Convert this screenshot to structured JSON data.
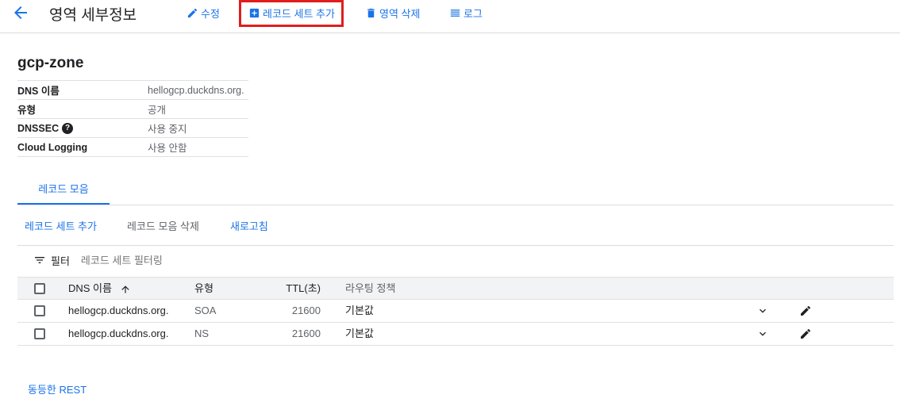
{
  "header": {
    "title": "영역 세부정보",
    "buttons": {
      "edit": "수정",
      "add_record_set": "레코드 세트 추가",
      "delete_zone": "영역 삭제",
      "logs": "로그"
    }
  },
  "zone": {
    "name": "gcp-zone",
    "details": [
      {
        "label": "DNS 이름",
        "value": "hellogcp.duckdns.org."
      },
      {
        "label": "유형",
        "value": "공개"
      },
      {
        "label": "DNSSEC",
        "value": "사용 중지"
      },
      {
        "label": "Cloud Logging",
        "value": "사용 안함"
      }
    ]
  },
  "tabs": [
    {
      "label": "레코드 모음"
    }
  ],
  "actions": {
    "add_record_set": "레코드 세트 추가",
    "delete_records": "레코드 모음 삭제",
    "refresh": "새로고침"
  },
  "filter": {
    "label": "필터",
    "placeholder": "레코드 세트 필터링"
  },
  "table": {
    "columns": {
      "dns": "DNS 이름",
      "type": "유형",
      "ttl": "TTL(초)",
      "routing": "라우팅 정책"
    },
    "rows": [
      {
        "dns": "hellogcp.duckdns.org.",
        "type": "SOA",
        "ttl": "21600",
        "routing": "기본값"
      },
      {
        "dns": "hellogcp.duckdns.org.",
        "type": "NS",
        "ttl": "21600",
        "routing": "기본값"
      }
    ]
  },
  "footer": {
    "rest_link": "동등한 REST"
  },
  "colors": {
    "accent": "#1a73e8",
    "highlight": "#e01e1e"
  },
  "icons": [
    "back-arrow-icon",
    "pencil-icon",
    "plus-box-icon",
    "trash-icon",
    "list-icon",
    "help-icon",
    "filter-icon",
    "sort-arrow-up-icon",
    "chevron-down-icon",
    "pencil-icon"
  ]
}
